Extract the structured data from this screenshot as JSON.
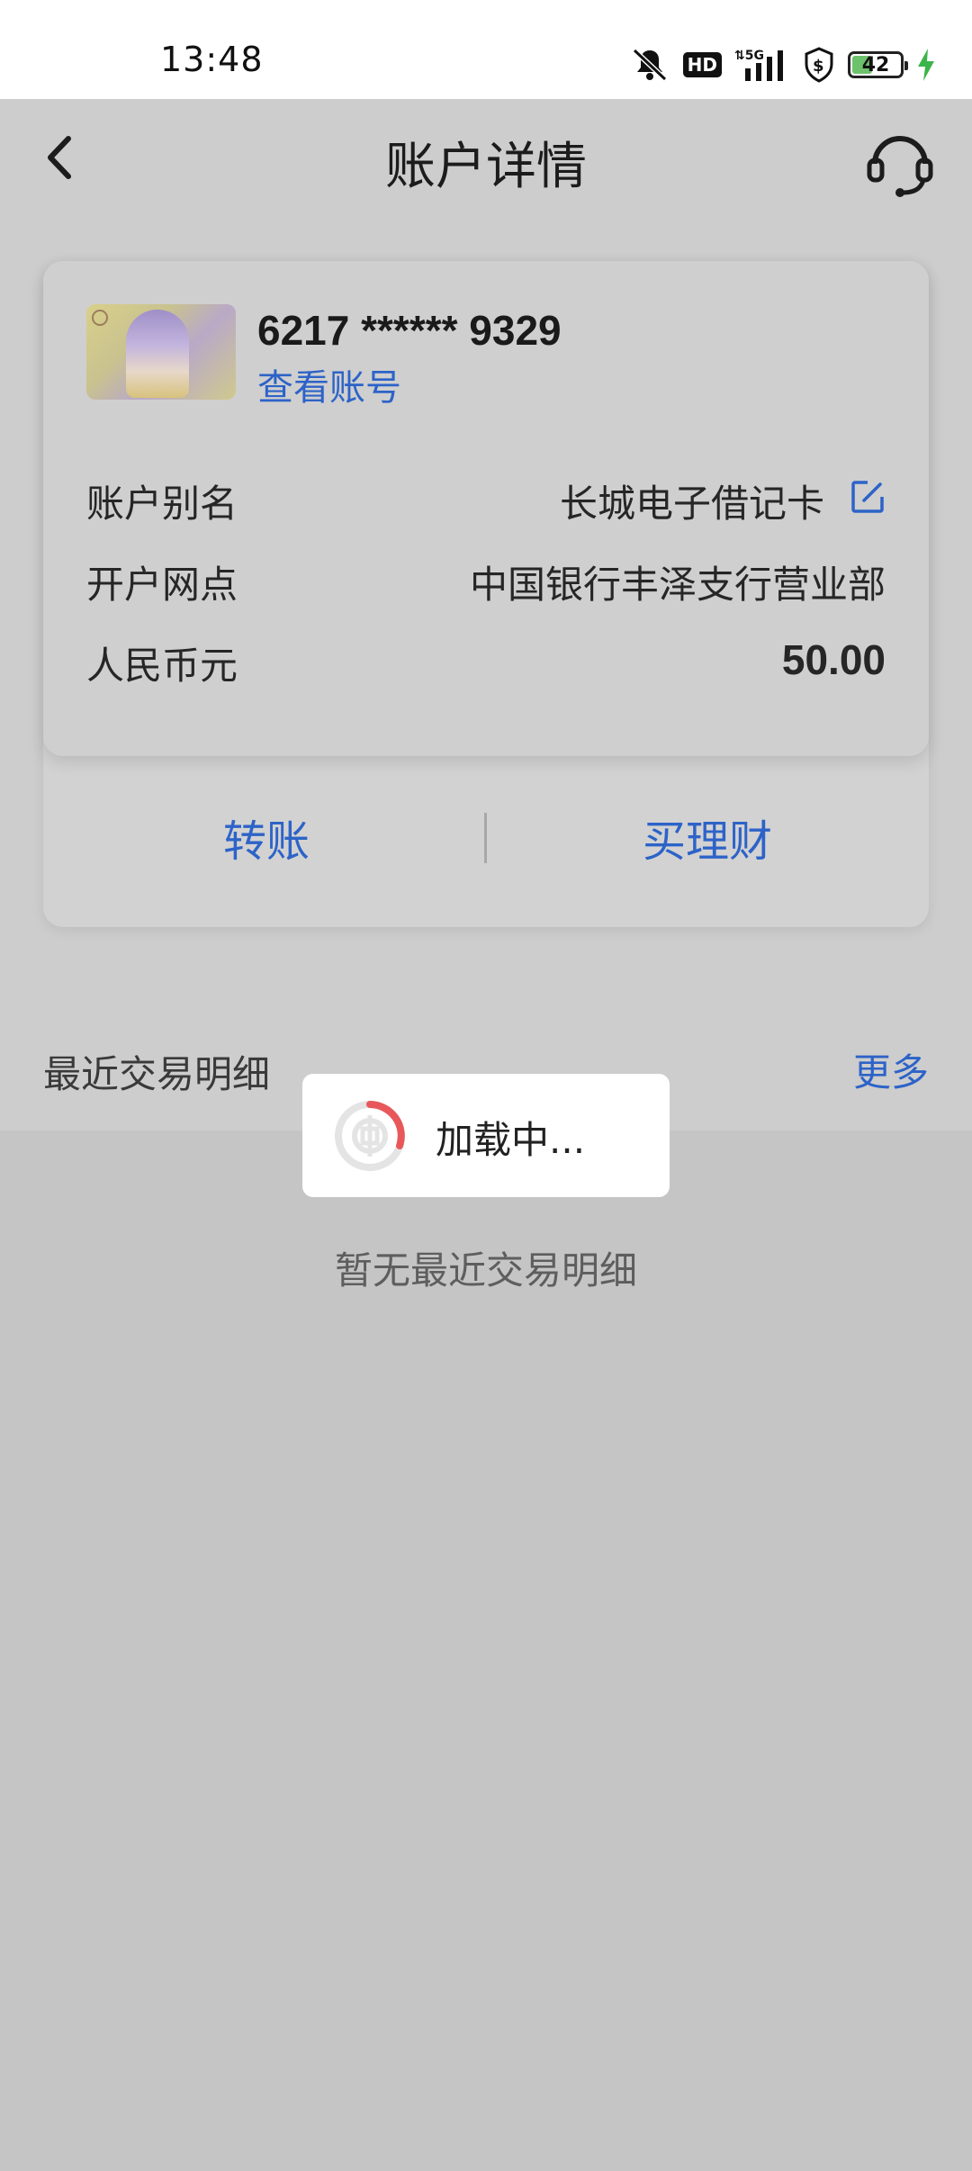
{
  "status_bar": {
    "time": "13:48",
    "network": "5G",
    "hd": "HD",
    "battery": "42"
  },
  "header": {
    "title": "账户详情"
  },
  "account": {
    "card_number": "6217 ****** 9329",
    "view_account_label": "查看账号",
    "rows": [
      {
        "label": "账户别名",
        "value": "长城电子借记卡"
      },
      {
        "label": "开户网点",
        "value": "中国银行丰泽支行营业部"
      },
      {
        "label": "人民币元",
        "value": "50.00"
      }
    ]
  },
  "actions": {
    "transfer": "转账",
    "buy_finance": "买理财"
  },
  "recent": {
    "title": "最近交易明细",
    "more": "更多",
    "empty": "暂无最近交易明细"
  },
  "toast": {
    "text": "加载中..."
  },
  "colors": {
    "accent": "#2d63c8",
    "battery_fill": "#6cc16b",
    "overlay": "#c5c5c5"
  }
}
